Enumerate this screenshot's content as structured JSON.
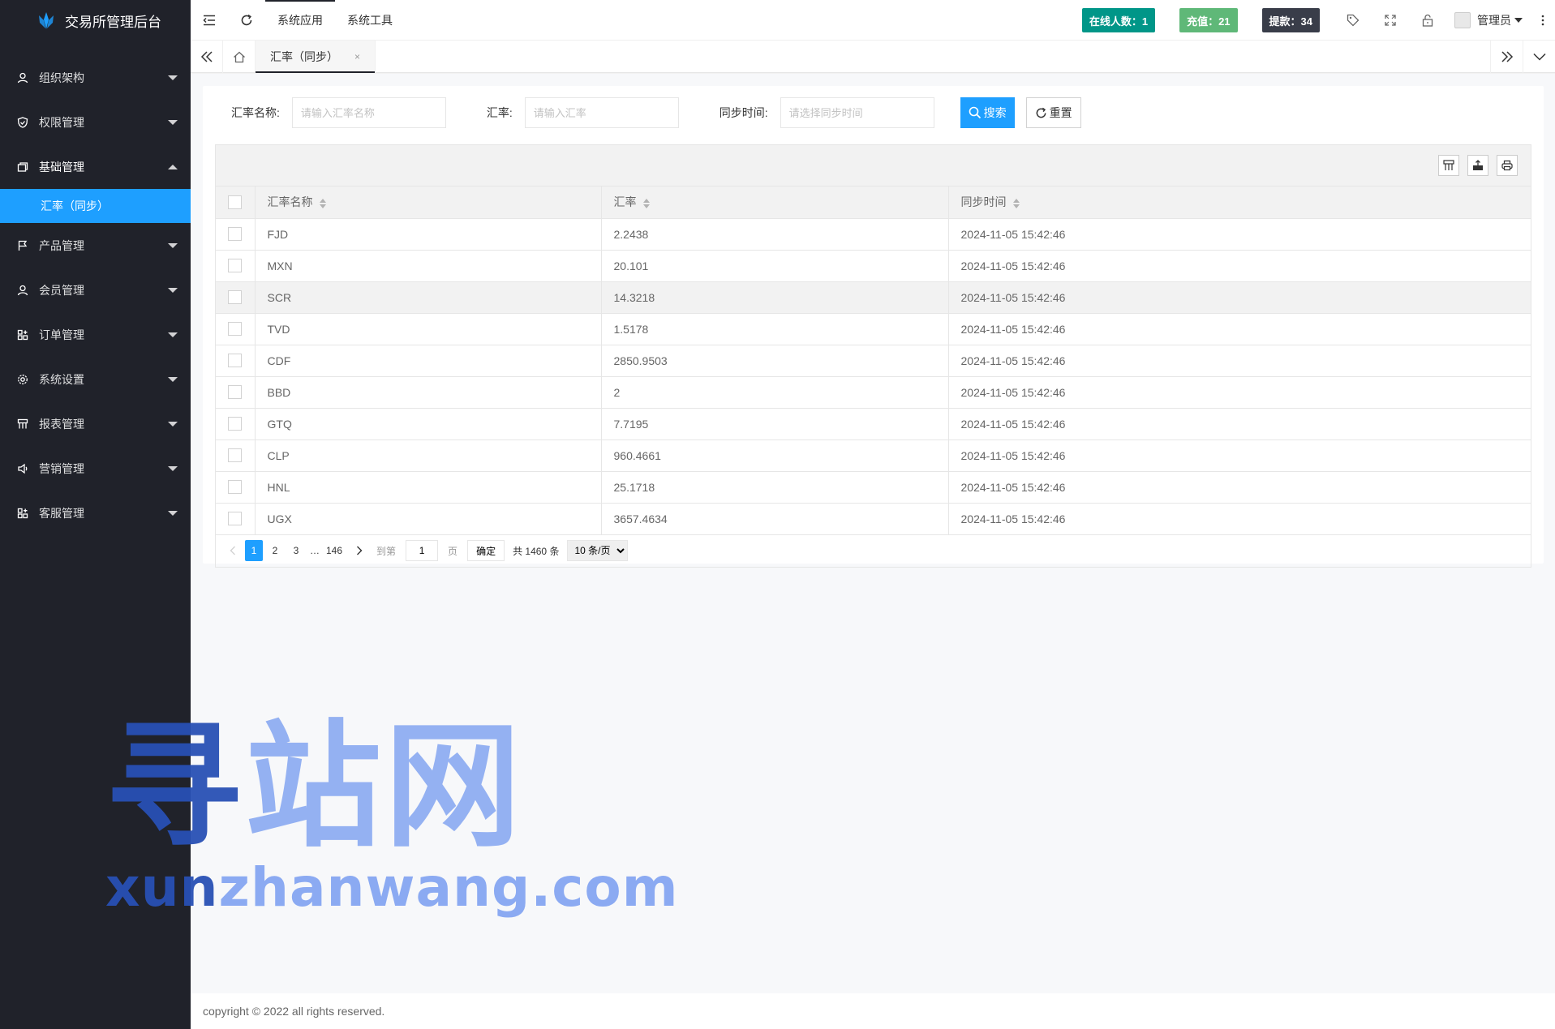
{
  "app": {
    "title": "交易所管理后台"
  },
  "sidebar": {
    "items": [
      {
        "label": "组织架构",
        "icon": "user-icon"
      },
      {
        "label": "权限管理",
        "icon": "shield-icon"
      },
      {
        "label": "基础管理",
        "icon": "database-icon"
      },
      {
        "label": "产品管理",
        "icon": "flag-icon"
      },
      {
        "label": "会员管理",
        "icon": "member-icon"
      },
      {
        "label": "订单管理",
        "icon": "order-icon"
      },
      {
        "label": "系统设置",
        "icon": "gear-icon"
      },
      {
        "label": "报表管理",
        "icon": "report-icon"
      },
      {
        "label": "营销管理",
        "icon": "speaker-icon"
      },
      {
        "label": "客服管理",
        "icon": "service-icon"
      }
    ],
    "active_sub": "汇率（同步）"
  },
  "header": {
    "tabs": [
      "系统应用",
      "系统工具"
    ],
    "online_label": "在线人数：1",
    "recharge_label": "充值：21",
    "withdraw_label": "提款：34",
    "user_name": "管理员"
  },
  "tabsbar": {
    "current_tab": "汇率（同步）",
    "close_glyph": "×"
  },
  "search": {
    "name_label": "汇率名称:",
    "name_placeholder": "请输入汇率名称",
    "rate_label": "汇率:",
    "rate_placeholder": "请输入汇率",
    "time_label": "同步时间:",
    "time_placeholder": "请选择同步时间",
    "search_button": "搜索",
    "reset_button": "重置"
  },
  "table": {
    "columns": [
      "汇率名称",
      "汇率",
      "同步时间"
    ],
    "rows": [
      {
        "name": "FJD",
        "rate": "2.2438",
        "time": "2024-11-05 15:42:46"
      },
      {
        "name": "MXN",
        "rate": "20.101",
        "time": "2024-11-05 15:42:46"
      },
      {
        "name": "SCR",
        "rate": "14.3218",
        "time": "2024-11-05 15:42:46"
      },
      {
        "name": "TVD",
        "rate": "1.5178",
        "time": "2024-11-05 15:42:46"
      },
      {
        "name": "CDF",
        "rate": "2850.9503",
        "time": "2024-11-05 15:42:46"
      },
      {
        "name": "BBD",
        "rate": "2",
        "time": "2024-11-05 15:42:46"
      },
      {
        "name": "GTQ",
        "rate": "7.7195",
        "time": "2024-11-05 15:42:46"
      },
      {
        "name": "CLP",
        "rate": "960.4661",
        "time": "2024-11-05 15:42:46"
      },
      {
        "name": "HNL",
        "rate": "25.1718",
        "time": "2024-11-05 15:42:46"
      },
      {
        "name": "UGX",
        "rate": "3657.4634",
        "time": "2024-11-05 15:42:46"
      }
    ]
  },
  "pager": {
    "pages": [
      "1",
      "2",
      "3"
    ],
    "ellipsis": "…",
    "last_page": "146",
    "goto_label": "到第",
    "goto_value": "1",
    "page_unit": "页",
    "confirm": "确定",
    "total": "共 1460 条",
    "page_size": "10 条/页"
  },
  "footer": {
    "copyright": "copyright © 2022 all rights reserved."
  },
  "watermark": {
    "cn_1": "寻",
    "cn_2": "站网",
    "en_1": "xun",
    "en_2": "zhanwang.com"
  },
  "colors": {
    "sidebar_bg": "#20222a",
    "accent": "#1e9fff",
    "online_badge": "#009688",
    "recharge_badge": "#5fb878",
    "withdraw_badge": "#393d49"
  }
}
